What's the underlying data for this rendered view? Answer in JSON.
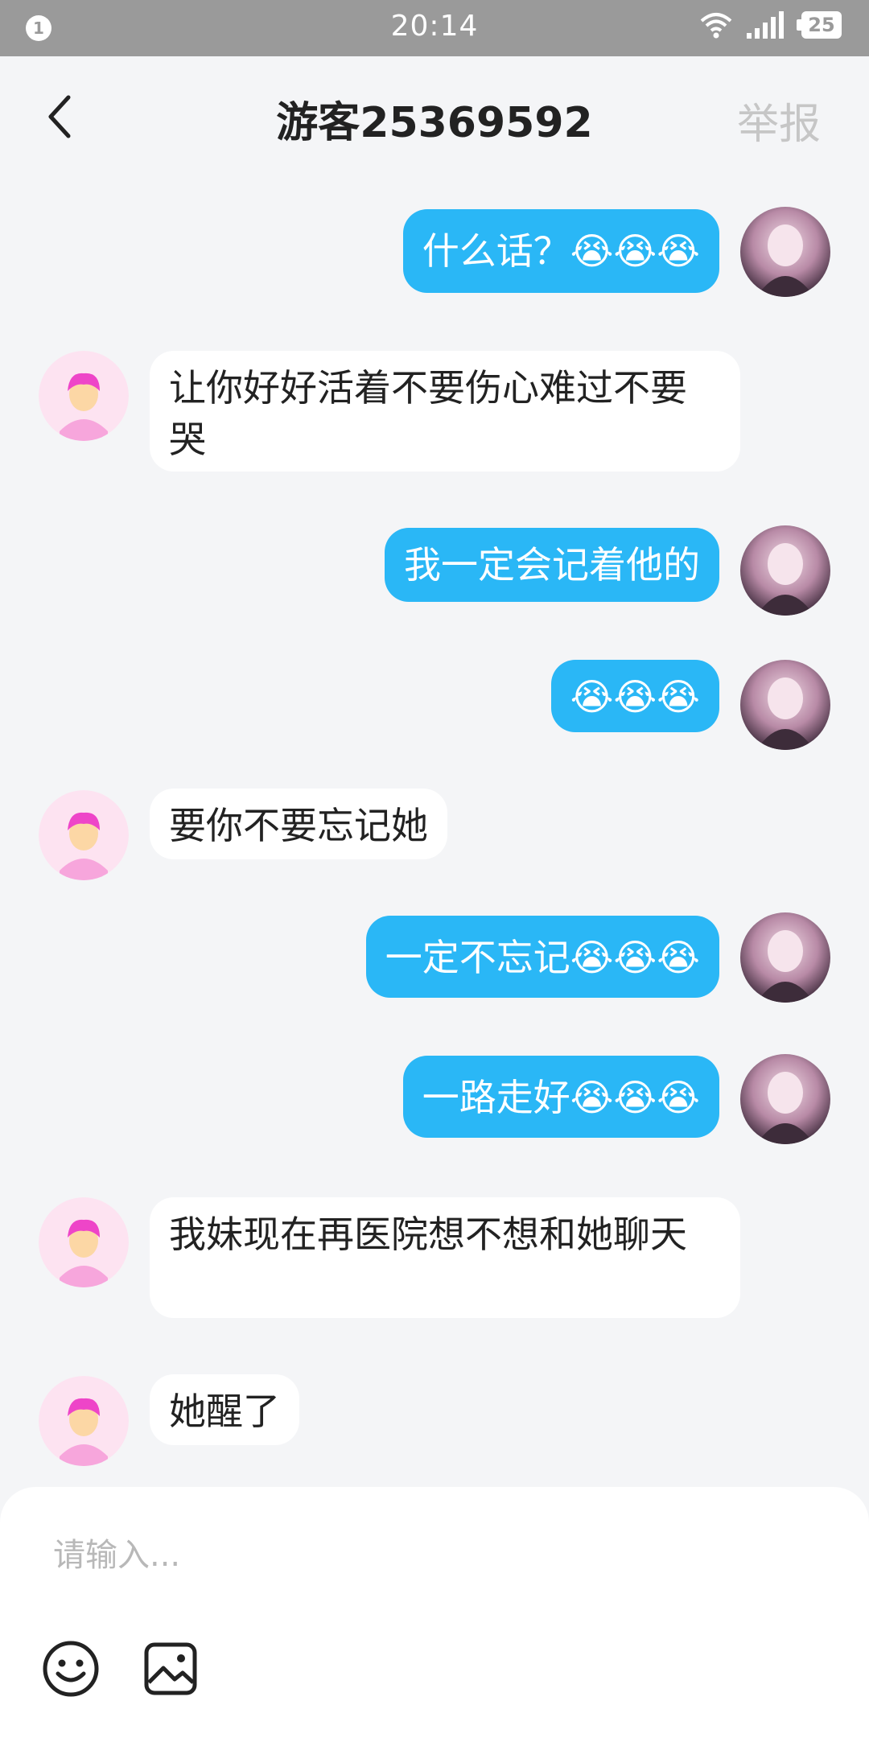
{
  "status_bar": {
    "notification_count": "1",
    "time": "20:14",
    "battery": "25"
  },
  "header": {
    "title": "游客25369592",
    "report_label": "举报"
  },
  "messages": [
    {
      "side": "right",
      "text": "什么话？😭😭😭"
    },
    {
      "side": "left",
      "text": "让你好好活着不要伤心难过不要哭"
    },
    {
      "side": "right",
      "text": "我一定会记着他的"
    },
    {
      "side": "right",
      "text": "😭😭😭"
    },
    {
      "side": "left",
      "text": "要你不要忘记她"
    },
    {
      "side": "right",
      "text": "一定不忘记😭😭😭"
    },
    {
      "side": "right",
      "text": "一路走好😭😭😭"
    },
    {
      "side": "left",
      "text": "我妹现在再医院想不想和她聊天"
    },
    {
      "side": "left",
      "text": "她醒了"
    }
  ],
  "input": {
    "placeholder": "请输入...",
    "value": ""
  },
  "icons": {
    "back": "chevron-left-icon",
    "emoji": "smiley-icon",
    "image": "image-icon"
  },
  "colors": {
    "accent": "#2ab7f6",
    "background": "#f4f5f7",
    "status_bar": "#9a9a9a"
  }
}
